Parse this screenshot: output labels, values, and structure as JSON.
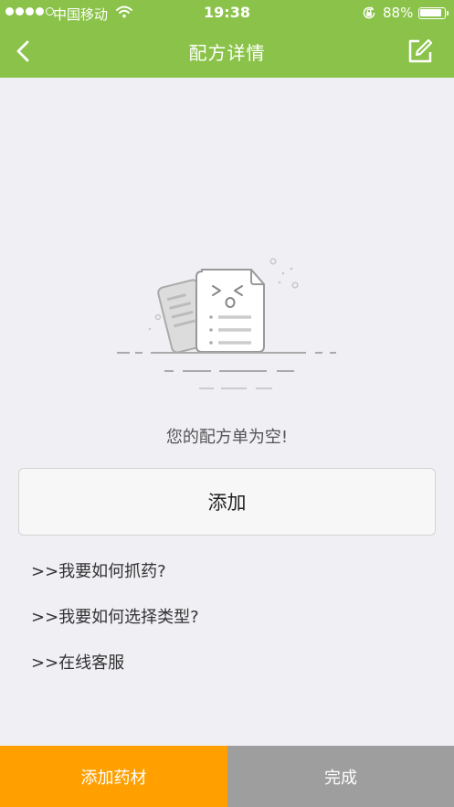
{
  "status_bar": {
    "carrier": "中国移动",
    "time": "19:38",
    "battery_percent": "88%",
    "signal_icon": "signal-dots-icon",
    "wifi_icon": "wifi-icon",
    "lock_icon": "orientation-lock-icon",
    "battery_icon": "battery-icon",
    "battery_level": 0.88
  },
  "nav": {
    "title": "配方详情",
    "back_icon": "chevron-left-icon",
    "edit_icon": "edit-square-icon"
  },
  "empty_state": {
    "illustration_icon": "empty-document-icon",
    "message": "您的配方单为空!"
  },
  "actions": {
    "add_label": "添加"
  },
  "help_links": [
    {
      "label": ">>我要如何抓药?"
    },
    {
      "label": ">>我要如何选择类型?"
    },
    {
      "label": ">>在线客服"
    }
  ],
  "bottom_bar": {
    "add_medicine_label": "添加药材",
    "done_label": "完成"
  },
  "colors": {
    "header": "#8bc34a",
    "background": "#efeff4",
    "add_medicine": "#ffa000",
    "done": "#9e9e9e"
  }
}
